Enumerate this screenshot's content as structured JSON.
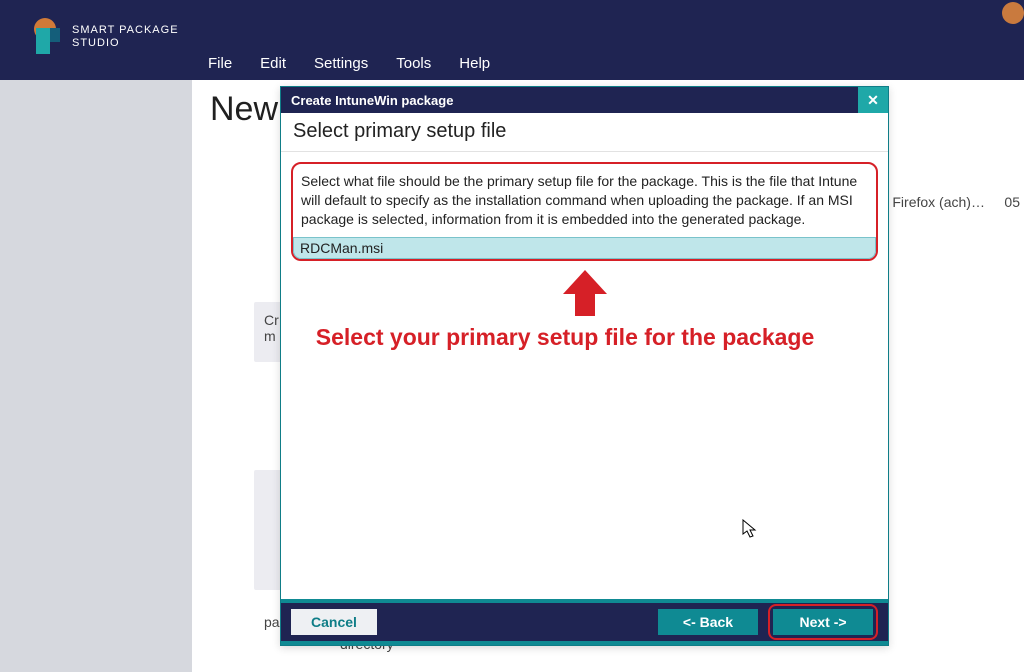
{
  "app": {
    "name_line1": "SMART PACKAGE",
    "name_line2": "STUDIO"
  },
  "menu": {
    "file": "File",
    "edit": "Edit",
    "settings": "Settings",
    "tools": "Tools",
    "help": "Help"
  },
  "page": {
    "title": "New",
    "bg_right_line1": "zilla Firefox (ach)…",
    "bg_right_line2": "05",
    "bg_frag_cr1": "Cr",
    "bg_frag_cr2": "m",
    "bg_frag_pa": "pa",
    "bg_frag_dir": "directory"
  },
  "dialog": {
    "title": "Create IntuneWin package",
    "close_glyph": "✕",
    "subtitle": "Select primary setup file",
    "instruction": "Select what file should be the primary setup file for the package. This is the file that Intune will default to specify as the installation command when uploading the package. If an MSI package is selected, information from it is embedded into the generated package.",
    "selected_file": "RDCMan.msi",
    "annotation": "Select your primary setup file for the package",
    "buttons": {
      "cancel": "Cancel",
      "back": "<- Back",
      "next": "Next ->"
    }
  }
}
